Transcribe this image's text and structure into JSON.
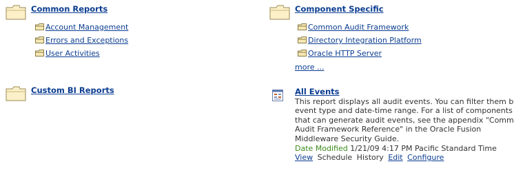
{
  "left_column": {
    "common_reports": {
      "title": "Common Reports",
      "items": [
        {
          "label": "Account Management"
        },
        {
          "label": "Errors and Exceptions"
        },
        {
          "label": "User Activities"
        }
      ]
    },
    "custom_bi_reports": {
      "title": "Custom BI Reports"
    }
  },
  "right_column": {
    "component_specific": {
      "title": "Component Specific",
      "items": [
        {
          "label": "Common Audit Framework"
        },
        {
          "label": "Directory Integration Platform"
        },
        {
          "label": "Oracle HTTP Server"
        }
      ],
      "more_label": "more ..."
    },
    "all_events": {
      "title": "All Events",
      "description": "This report displays all audit events. You can filter them by event type and date-time range. For a list of components that can generate audit events, see the appendix \"Common Audit Framework Reference\" in the Oracle Fusion Middleware Security Guide.",
      "date_modified_label": "Date Modified",
      "date_modified_value": "1/21/09 4:17 PM Pacific Standard Time",
      "actions": {
        "view": "View",
        "schedule": "Schedule",
        "history": "History",
        "edit": "Edit",
        "configure": "Configure"
      }
    }
  },
  "colors": {
    "link": "#0b3d91",
    "date_label": "#3a8a1a",
    "folder_fill": "#f7e9b5",
    "folder_stroke": "#9b8a55"
  }
}
